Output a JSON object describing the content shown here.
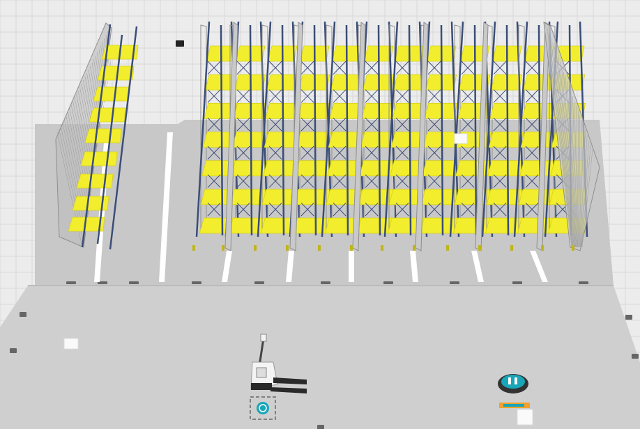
{
  "scene": {
    "name": "warehouse-3d-simulation-view",
    "colors": {
      "background": "#ececec",
      "grid_line": "#d9d9d9",
      "floor_zone": "#c8c8c8",
      "floor_zone_dark": "#bdbdbd",
      "lane_marking": "#ffffff",
      "shelf_yellow": "#f2ee2e",
      "shelf_yellow_edge": "#d7d11a",
      "upright_blue": "#3b4d78",
      "mesh_grey": "#8e8e8e",
      "agv_body": "#f4f4f4",
      "agv_dark": "#2a2a2a",
      "charger_teal": "#19a6b8",
      "label_orange": "#f2a22a"
    },
    "objects": {
      "rack_rows": 7,
      "shelf_levels": 7,
      "agv": "pallet-forklift-agv",
      "charging_station": "charging-pad",
      "parking_spot": "parking-marker",
      "cargo_boxes": 3
    }
  }
}
